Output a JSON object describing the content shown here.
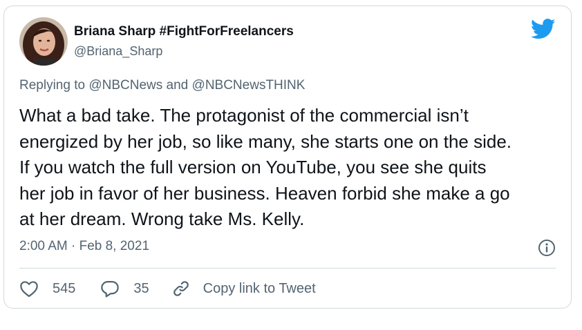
{
  "author": {
    "display_name": "Briana Sharp #FightForFreelancers",
    "handle": "@Briana_Sharp"
  },
  "reply_context": {
    "prefix": "Replying to ",
    "mention_1": "@NBCNews",
    "joiner": " and ",
    "mention_2": "@NBCNewsTHINK"
  },
  "tweet": {
    "text": "What a bad take. The protagonist of the commercial isn’t\nenergized by her job, so like many, she starts one on the side.\nIf you watch the full version on YouTube, you see she quits\nher job in favor of her business. Heaven forbid she make a go\nat her dream. Wrong take Ms. Kelly.",
    "timestamp": "2:00 AM · Feb 8, 2021"
  },
  "actions": {
    "likes": "545",
    "replies": "35",
    "copy_link_label": "Copy link to Tweet"
  },
  "colors": {
    "twitter_blue": "#1d9bf0",
    "secondary_text": "#536471",
    "border": "#cfd9de"
  },
  "icons": [
    "twitter-bird-icon",
    "info-icon",
    "heart-icon",
    "reply-bubble-icon",
    "link-icon"
  ]
}
